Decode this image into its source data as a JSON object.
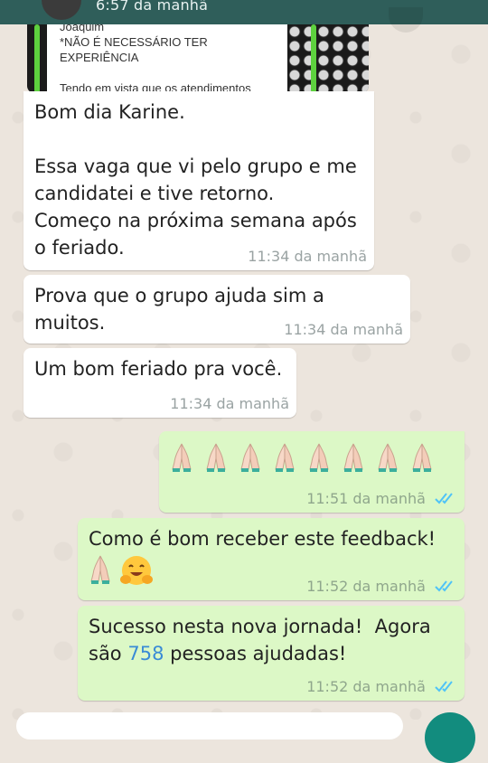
{
  "header": {
    "time_text": "6:57 da manhã"
  },
  "preview": {
    "lines": [
      "Joaquim",
      "*NÃO É NECESSÁRIO TER",
      "EXPERIÊNCIA",
      "",
      "Tendo em vista que os atendimentos"
    ]
  },
  "messages": [
    {
      "text": "Bom dia Karine.\n\nEssa vaga que vi pelo grupo e me\ncandidatei e tive retorno.\nComeço na próxima semana após\no feriado.",
      "time": "11:34 da manhã"
    },
    {
      "text": "Prova que o grupo ajuda sim a\nmuitos.",
      "time": "11:34 da manhã"
    },
    {
      "text": "Um bom feriado pra você.",
      "time": "11:34 da manhã"
    },
    {
      "time": "11:51 da manhã",
      "emoji_count": 8
    },
    {
      "text": "Como é bom receber este feedback!",
      "time": "11:52 da manhã"
    },
    {
      "text_before": "Sucesso nesta nova jornada!  Agora\nsão ",
      "link_number": "758",
      "text_after": " pessoas ajudadas!",
      "time": "11:52 da manhã"
    }
  ],
  "colors": {
    "header": "#2F5E5A",
    "incoming": "#FFFFFF",
    "outgoing": "#DCF8C6",
    "read_ticks": "#4FC3F7",
    "link": "#3A8BD6"
  }
}
